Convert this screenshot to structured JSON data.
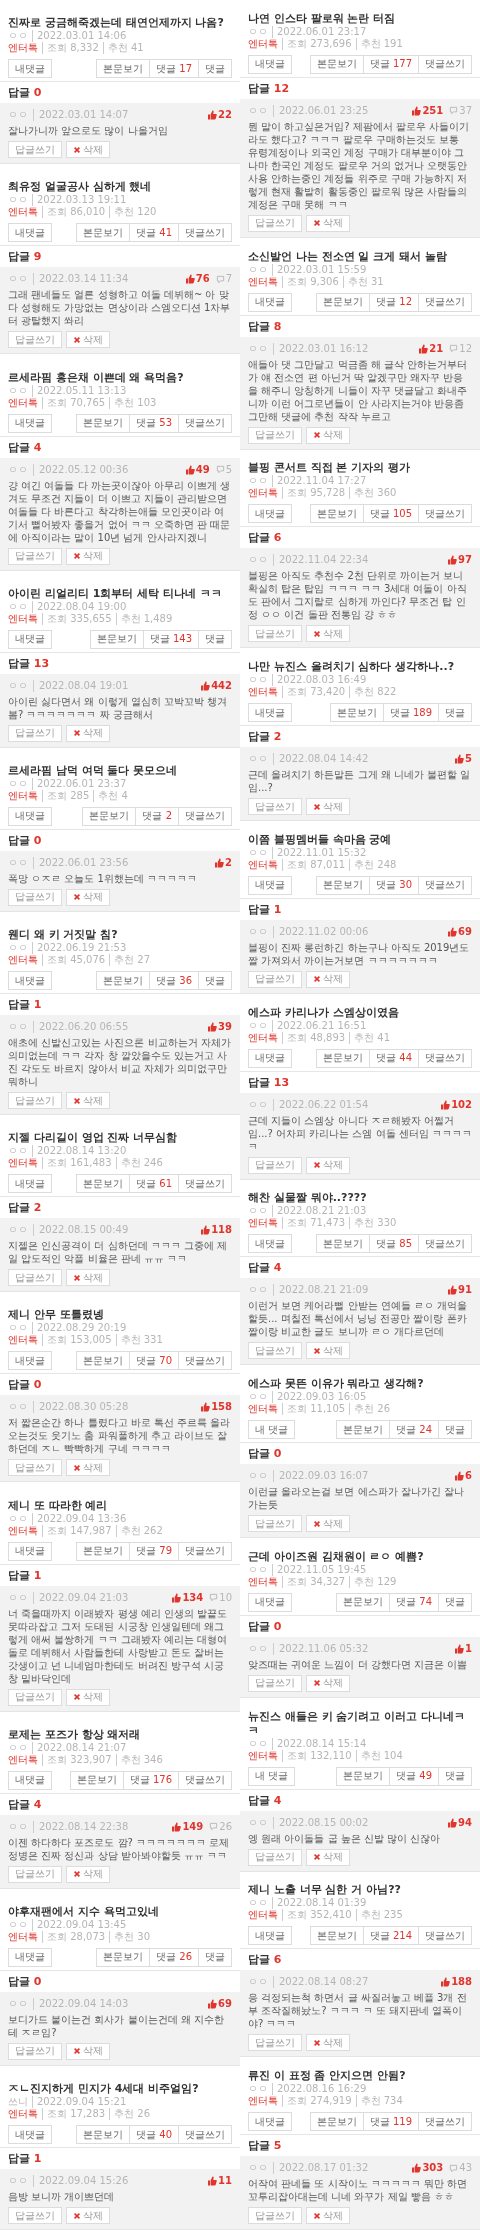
{
  "columns": [
    {
      "posts": [
        {
          "title": "진짜로 궁금해죽겠는데 태연언제까지 나옴?",
          "author": "ㅇㅇ",
          "date": "2022.03.01 14:06",
          "category": "엔터톡",
          "views": "조회 8,332",
          "recommends": "추천 41",
          "my_comments": "내댓글",
          "actions": [
            {
              "label": "본문보기"
            },
            {
              "label": "댓글",
              "count": "17"
            },
            {
              "label": "댓글"
            }
          ],
          "reply_header": {
            "label": "답글",
            "count": "0"
          },
          "reply": {
            "author": "ㅇㅇ",
            "date": "2022.03.01 14:07",
            "likes": "22",
            "text": "잘나가니까 앞으로도 많이 나올거임",
            "buttons": [
              {
                "kind": "reply",
                "label": "답글쓰기"
              },
              {
                "kind": "delete",
                "label": "삭제"
              }
            ]
          }
        },
        {
          "title": "최유정 얼굴공사 심하게 했네",
          "author": "ㅇㅇ",
          "date": "2022.03.13 19:11",
          "category": "엔터톡",
          "views": "조회 86,010",
          "recommends": "추천 120",
          "my_comments": "내댓글",
          "actions": [
            {
              "label": "본문보기"
            },
            {
              "label": "댓글",
              "count": "41"
            },
            {
              "label": "댓글쓰기"
            }
          ],
          "reply_header": {
            "label": "답글",
            "count": "9"
          },
          "reply": {
            "author": "ㅇㅇ",
            "date": "2022.03.14 11:34",
            "likes": "76",
            "dislikes": "7",
            "text": "그래 팬네들도 얼른 성형하고 여돌 데뷔해~ 아 맞다 성형해도 가망없는 면상이라 스엠오디션 1차부터 광탈했지 쏴리",
            "buttons": [
              {
                "kind": "reply",
                "label": "답글쓰기"
              },
              {
                "kind": "delete",
                "label": "삭제"
              }
            ]
          }
        },
        {
          "title": "르세라핌 홍은채 이쁜데 왜 욕먹음?",
          "author": "ㅇㅇ",
          "date": "2022.05.11 13:13",
          "category": "엔터톡",
          "views": "조회 70,765",
          "recommends": "추천 103",
          "my_comments": "내댓글",
          "actions": [
            {
              "label": "본문보기"
            },
            {
              "label": "댓글",
              "count": "53"
            },
            {
              "label": "댓글쓰기"
            }
          ],
          "reply_header": {
            "label": "답글",
            "count": "4"
          },
          "reply": {
            "author": "ㅇㅇ",
            "date": "2022.05.12 00:36",
            "likes": "49",
            "dislikes": "5",
            "text": "걍 여긴 여돌들 다 까는곳이잖아 아무리 이쁘게 생겨도 무조건 지들이 더 이쁘고 지들이 관리받으면 여돌들 다 바른다고 착각하는애들 모인곳이라 여기서 뻘어봤자 좋을거 없어 ㅋㅋ 오죽하면 판 때문에 아직이라는 말이 10년 넘게 안사라지겠니",
            "buttons": [
              {
                "kind": "reply",
                "label": "답글쓰기"
              },
              {
                "kind": "delete",
                "label": "삭제"
              }
            ]
          }
        },
        {
          "title": "아이린 리얼리티 1회부터 세탁 티나네 ㅋㅋ",
          "author": "ㅇㅇ",
          "date": "2022.08.04 19:00",
          "category": "엔터톡",
          "views": "조회 335,655",
          "recommends": "추천 1,489",
          "my_comments": "내댓글",
          "actions": [
            {
              "label": "본문보기"
            },
            {
              "label": "댓글",
              "count": "143"
            },
            {
              "label": "댓글"
            }
          ],
          "reply_header": {
            "label": "답글",
            "count": "13"
          },
          "reply": {
            "author": "ㅇㅇ",
            "date": "2022.08.04 19:01",
            "likes": "442",
            "text": "아이린 싫다면서 왜 이렇게 열심히 꼬박꼬박 챙겨봄? ㅋㅋㅋㅋㅋㅋㅋ 짜 궁금해서",
            "buttons": [
              {
                "kind": "reply",
                "label": "답글쓰기"
              },
              {
                "kind": "delete",
                "label": "삭제"
              }
            ]
          }
        },
        {
          "title": "르세라핌 남덕 여덕 둘다 못모으네",
          "author": "ㅇㅇ",
          "date": "2022.06.01 23:37",
          "category": "엔터톡",
          "views": "조회 285",
          "recommends": "추천 4",
          "my_comments": "내댓글",
          "actions": [
            {
              "label": "본문보기"
            },
            {
              "label": "댓글",
              "count": "2"
            },
            {
              "label": "댓글쓰기"
            }
          ],
          "reply_header": {
            "label": "답글",
            "count": "0"
          },
          "reply": {
            "author": "ㅇㅇ",
            "date": "2022.06.01 23:56",
            "likes": "2",
            "text": "폭망 ㅇㅈㄹ 오늘도 1위했는데 ㅋㅋㅋㅋㅋ",
            "buttons": [
              {
                "kind": "reply",
                "label": "답글쓰기"
              },
              {
                "kind": "delete",
                "label": "삭제"
              }
            ]
          }
        },
        {
          "title": "웬디 왜 키 거짓말 침?",
          "author": "ㅇㅇ",
          "date": "2022.06.19 21:53",
          "category": "엔터톡",
          "views": "조회 45,076",
          "recommends": "추천 27",
          "my_comments": "내댓글",
          "actions": [
            {
              "label": "본문보기"
            },
            {
              "label": "댓글",
              "count": "36"
            },
            {
              "label": "댓글"
            }
          ],
          "reply_header": {
            "label": "답글",
            "count": "1"
          },
          "reply": {
            "author": "ㅇㅇ",
            "date": "2022.06.20 06:55",
            "likes": "39",
            "text": "애초에 신발신고있는 사진으론 비교하는거 자체가 의미없는데 ㅋㅋ 각자 창 깔았을수도 있는거고 사진 각도도 바르지 않아서 비교 자체가 의미없구만 뭐하니",
            "buttons": [
              {
                "kind": "reply",
                "label": "답글쓰기"
              },
              {
                "kind": "delete",
                "label": "삭제"
              }
            ]
          }
        },
        {
          "title": "지젤 다리길이 영업 진짜 너무심함",
          "author": "ㅇㅇ",
          "date": "2022.08.14 13:20",
          "category": "엔터톡",
          "views": "조회 161,483",
          "recommends": "추천 246",
          "my_comments": "내댓글",
          "actions": [
            {
              "label": "본문보기"
            },
            {
              "label": "댓글",
              "count": "61"
            },
            {
              "label": "댓글쓰기"
            }
          ],
          "reply_header": {
            "label": "답글",
            "count": "2"
          },
          "reply": {
            "author": "ㅇㅇ",
            "date": "2022.08.15 00:49",
            "likes": "118",
            "text": "지젤은 인신공격이 더 심하던데 ㅋㅋㅋ 그중에 제일 압도적인 악플 비율은 판네 ㅠㅠ ㅋㅋ",
            "buttons": [
              {
                "kind": "reply",
                "label": "답글쓰기"
              },
              {
                "kind": "delete",
                "label": "삭제"
              }
            ]
          }
        },
        {
          "title": "제니 안무 또틀렸넹",
          "author": "ㅇㅇ",
          "date": "2022.08.29 20:19",
          "category": "엔터톡",
          "views": "조회 153,005",
          "recommends": "추천 331",
          "my_comments": "내댓글",
          "actions": [
            {
              "label": "본문보기"
            },
            {
              "label": "댓글",
              "count": "70"
            },
            {
              "label": "댓글쓰기"
            }
          ],
          "reply_header": {
            "label": "답글",
            "count": "0"
          },
          "reply": {
            "author": "ㅇㅇ",
            "date": "2022.08.30 05:28",
            "likes": "158",
            "text": "저 짧은순간 하나 틀렸다고 바로 톡선 주르륵 올라오는것도 웃기노 춤 파워풀하게 추고 라이브도 잘하던데 ㅈㄴ 빡빡하게 구네 ㅋㅋㅋㅋ",
            "buttons": [
              {
                "kind": "reply",
                "label": "답글쓰기"
              },
              {
                "kind": "delete",
                "label": "삭제"
              }
            ]
          }
        },
        {
          "title": "제니 또 따라한 예리",
          "author": "ㅇㅇ",
          "date": "2022.09.04 13:36",
          "category": "엔터톡",
          "views": "조회 147,987",
          "recommends": "추천 262",
          "my_comments": "내댓글",
          "actions": [
            {
              "label": "본문보기"
            },
            {
              "label": "댓글",
              "count": "79"
            },
            {
              "label": "댓글쓰기"
            }
          ],
          "reply_header": {
            "label": "답글",
            "count": "1"
          },
          "reply": {
            "author": "ㅇㅇ",
            "date": "2022.09.04 21:03",
            "likes": "134",
            "dislikes": "10",
            "text": "너 죽을때까지 이래봤자 평생 예리 인생의 발끝도 못따라잡고 그저 도태된 시궁창 인생일텐데 왜그렇게 애써 불쌍하게 ㅋㅋ 그래봤자 예리는 대형여돌로 데뷔해서 사람들한테 사랑받고 돈도 잘버는 갓생이고 넌 니네엄마한테도 버려진 방구석 시궁창 밑바닥인데",
            "buttons": [
              {
                "kind": "reply",
                "label": "답글쓰기"
              },
              {
                "kind": "delete",
                "label": "삭제"
              }
            ]
          }
        },
        {
          "title": "로제는 포즈가 항상 왜저래",
          "author": "ㅇㅇ",
          "date": "2022.08.14 21:07",
          "category": "엔터톡",
          "views": "조회 323,907",
          "recommends": "추천 346",
          "my_comments": "내댓글",
          "actions": [
            {
              "label": "본문보기"
            },
            {
              "label": "댓글",
              "count": "176"
            },
            {
              "label": "댓글쓰기"
            }
          ],
          "reply_header": {
            "label": "답글",
            "count": "4"
          },
          "reply": {
            "author": "ㅇㅇ",
            "date": "2022.08.14 22:38",
            "likes": "149",
            "dislikes": "26",
            "text": "이젠 하다하다 포즈로도 깜? ㅋㅋㅋㅋㅋㅋㅋ 로제 정병은 진짜 정신과 상담 받아봐야할듯 ㅠㅠ ㅋㅋ",
            "buttons": [
              {
                "kind": "reply",
                "label": "답글쓰기"
              },
              {
                "kind": "delete",
                "label": "삭제"
              }
            ]
          }
        },
        {
          "title": "야후재팬에서 지수 욕먹고있네",
          "author": "ㅇㅇ",
          "date": "2022.09.04 13:45",
          "category": "엔터톡",
          "views": "조회 28,073",
          "recommends": "추천 30",
          "my_comments": "내댓글",
          "actions": [
            {
              "label": "본문보기"
            },
            {
              "label": "댓글",
              "count": "26"
            },
            {
              "label": "댓글"
            }
          ],
          "reply_header": {
            "label": "답글",
            "count": "0"
          },
          "reply": {
            "author": "ㅇㅇ",
            "date": "2022.09.04 14:03",
            "likes": "69",
            "text": "보디가드 붙이는건 회사가 붙이는건데 왜 지수한테 ㅈㄹ임?",
            "buttons": [
              {
                "kind": "reply",
                "label": "답글쓰기"
              },
              {
                "kind": "delete",
                "label": "삭제"
              }
            ]
          }
        },
        {
          "title": "ㅈㄴ진지하게 민지가 4세대 비주얼임?",
          "author": "쓰니",
          "date": "2022.09.04 15:21",
          "category": "엔터톡",
          "views": "조회 17,283",
          "recommends": "추천 26",
          "my_comments": "내댓글",
          "actions": [
            {
              "label": "본문보기"
            },
            {
              "label": "댓글",
              "count": "40"
            },
            {
              "label": "댓글쓰기"
            }
          ],
          "reply_header": {
            "label": "답글",
            "count": "1"
          },
          "reply": {
            "author": "ㅇㅇ",
            "date": "2022.09.04 15:26",
            "likes": "11",
            "text": "음방 보니까 개이쁘던데",
            "buttons": [
              {
                "kind": "reply",
                "label": "답글쓰기"
              },
              {
                "kind": "delete",
                "label": "삭제"
              }
            ]
          }
        }
      ]
    },
    {
      "posts": [
        {
          "title": "나연 인스타 팔로워 논란 터짐",
          "author": "ㅇㅇ",
          "date": "2022.06.01 23:17",
          "category": "엔터톡",
          "views": "조회 273,696",
          "recommends": "추천 191",
          "my_comments": "내댓글",
          "actions": [
            {
              "label": "본문보기"
            },
            {
              "label": "댓글",
              "count": "177"
            },
            {
              "label": "댓글쓰기"
            }
          ],
          "reply_header": {
            "label": "답글",
            "count": "12"
          },
          "reply": {
            "author": "ㅇㅇ",
            "date": "2022.06.01 23:25",
            "likes": "251",
            "dislikes": "37",
            "text": "뭔 말이 하고싶은거임? 제팜에서 팔로우 사들이기라도 했다고? ㅋㅋㅋ 팔로우 구매하는것도 보통 유령계정이나 외국인 계정 구매가 대부분이야 그나마 한국인 계정도 팔로우 거의 없거나 오랫동안 사용 안하는중인 계정들 위주로 구매 가능하지 저렇게 현재 활발히 활동중인 팔로워 많은 사람들의 계정은 구매 못해 ㅋㅋ",
            "buttons": [
              {
                "kind": "reply",
                "label": "답글쓰기"
              },
              {
                "kind": "delete",
                "label": "삭제"
              }
            ]
          }
        },
        {
          "title": "소신발언 나는 전소연 일 크게 돼서 놀람",
          "author": "ㅇㅇ",
          "date": "2022.03.01 15:59",
          "category": "엔터톡",
          "views": "조회 9,306",
          "recommends": "추천 31",
          "my_comments": "내댓글",
          "actions": [
            {
              "label": "본문보기"
            },
            {
              "label": "댓글",
              "count": "12"
            },
            {
              "label": "댓글쓰기"
            }
          ],
          "reply_header": {
            "label": "답글",
            "count": "8"
          },
          "reply": {
            "author": "ㅇㅇ",
            "date": "2022.03.01 16:12",
            "likes": "21",
            "dislikes": "12",
            "text": "애들아 댓 그만달고 먹금좀 해 글삭 안하는거부터가 얘 전소연 편 아닌거 딱 알겠구만 왜자꾸 반응을 해주니 앙칭하게 니들이 자꾸 댓글달고 화내주니까 이런 어그로년들이 안 사라지는거야 반응좀 그만해 댓글에 추천 작작 누르고",
            "buttons": [
              {
                "kind": "reply",
                "label": "답글쓰기"
              },
              {
                "kind": "delete",
                "label": "삭제"
              }
            ]
          }
        },
        {
          "title": "블핑 콘서트 직접 본 기자의 평가",
          "author": "ㅇㅇ",
          "date": "2022.11.04 17:27",
          "category": "엔터톡",
          "views": "조회 95,728",
          "recommends": "추천 360",
          "my_comments": "내댓글",
          "actions": [
            {
              "label": "본문보기"
            },
            {
              "label": "댓글",
              "count": "105"
            },
            {
              "label": "댓글쓰기"
            }
          ],
          "reply_header": {
            "label": "답글",
            "count": "6"
          },
          "reply": {
            "author": "ㅇㅇ",
            "date": "2022.11.04 22:34",
            "likes": "97",
            "text": "블핑은 아직도 추천수 2천 단위로 까이는거 보니 확실히 탑은 탑임 ㅋㅋㅋ ㅋㅋ 3세대 여돌이 아직도 판에서 그지랄로 심하게 까인다? 무조건 탑 인정 ㅇㅇ 이건 돌판 전통임 걍 ㅎㅎ",
            "buttons": [
              {
                "kind": "reply",
                "label": "답글쓰기"
              },
              {
                "kind": "delete",
                "label": "삭제"
              }
            ]
          }
        },
        {
          "title": "나만 뉴진스 올려치기 심하다 생각하나..?",
          "author": "ㅇㅇ",
          "date": "2022.08.03 16:49",
          "category": "엔터톡",
          "views": "조회 73,420",
          "recommends": "추천 822",
          "my_comments": "내댓글",
          "actions": [
            {
              "label": "본문보기"
            },
            {
              "label": "댓글",
              "count": "189"
            },
            {
              "label": "댓글"
            }
          ],
          "reply_header": {
            "label": "답글",
            "count": "2"
          },
          "reply": {
            "author": "ㅇㅇ",
            "date": "2022.08.04 14:42",
            "likes": "5",
            "text": "근데 올려치기 하든말든 그게 왜 니네가 불편할 일임...?",
            "buttons": [
              {
                "kind": "reply",
                "label": "답글쓰기"
              },
              {
                "kind": "delete",
                "label": "삭제"
              }
            ]
          }
        },
        {
          "title": "이쯤 블핑멤버들 속마음 궁예",
          "author": "ㅇㅇ",
          "date": "2022.11.01 15:32",
          "category": "엔터톡",
          "views": "조회 87,011",
          "recommends": "추천 248",
          "my_comments": "내댓글",
          "actions": [
            {
              "label": "본문보기"
            },
            {
              "label": "댓글",
              "count": "30"
            },
            {
              "label": "댓글쓰기"
            }
          ],
          "reply_header": {
            "label": "답글",
            "count": "1"
          },
          "reply": {
            "author": "ㅇㅇ",
            "date": "2022.11.02 00:06",
            "likes": "69",
            "text": "블핑이 진짜 롱런하긴 하는구나 아직도 2019년도 짤 가져와서 까이는거보면 ㅋㅋㅋㅋㅋㅋㅋ",
            "buttons": [
              {
                "kind": "reply",
                "label": "답글쓰기"
              },
              {
                "kind": "delete",
                "label": "삭제"
              }
            ]
          }
        },
        {
          "title": "에스파 카리나가 스엠상이였음",
          "author": "ㅇㅇ",
          "date": "2022.06.21 16:51",
          "category": "엔터톡",
          "views": "조회 48,893",
          "recommends": "추천 41",
          "my_comments": "내댓글",
          "actions": [
            {
              "label": "본문보기"
            },
            {
              "label": "댓글",
              "count": "44"
            },
            {
              "label": "댓글쓰기"
            }
          ],
          "reply_header": {
            "label": "답글",
            "count": "13"
          },
          "reply": {
            "author": "ㅇㅇ",
            "date": "2022.06.22 01:54",
            "likes": "102",
            "text": "근데 지들이 스엠상 아니다 ㅈㄹ해봤자 어쩔거임...? 어차피 카리나는 스엠 여돌 센터임 ㅋㅋㅋㅋㅋ",
            "buttons": [
              {
                "kind": "reply",
                "label": "답글쓰기"
              },
              {
                "kind": "delete",
                "label": "삭제"
              }
            ]
          }
        },
        {
          "title": "해찬 실물짤 뭐야..????",
          "author": "ㅇㅇ",
          "date": "2022.08.21 21:03",
          "category": "엔터톡",
          "views": "조회 71,473",
          "recommends": "추천 330",
          "my_comments": "내댓글",
          "actions": [
            {
              "label": "본문보기"
            },
            {
              "label": "댓글",
              "count": "85"
            },
            {
              "label": "댓글쓰기"
            }
          ],
          "reply_header": {
            "label": "답글",
            "count": "4"
          },
          "reply": {
            "author": "ㅇㅇ",
            "date": "2022.08.21 21:09",
            "likes": "91",
            "text": "이런거 보면 케어라뻘 안받는 연예들 ㄹㅇ 개억울할듯... 며칠전 톡선에서 닝닝 전공만 짤이랑 폰카짤이랑 비교한 글도 보니까 ㄹㅇ 개다르던데",
            "buttons": [
              {
                "kind": "reply",
                "label": "답글쓰기"
              },
              {
                "kind": "delete",
                "label": "삭제"
              }
            ]
          }
        },
        {
          "title": "에스파 못뜬 이유가 뭐라고 생각해?",
          "author": "ㅇㅇ",
          "date": "2022.09.03 16:05",
          "category": "엔터톡",
          "views": "조회 11,105",
          "recommends": "추천 26",
          "my_comments": "내 댓글",
          "actions": [
            {
              "label": "본문보기"
            },
            {
              "label": "댓글",
              "count": "24"
            },
            {
              "label": "댓글"
            }
          ],
          "reply_header": {
            "label": "답글",
            "count": "0"
          },
          "reply": {
            "author": "ㅇㅇ",
            "date": "2022.09.03 16:07",
            "likes": "6",
            "text": "이런글 올라오는걸 보면 에스파가 잘나가긴 잘나가는듯",
            "buttons": [
              {
                "kind": "reply",
                "label": "답글쓰기"
              },
              {
                "kind": "delete",
                "label": "삭제"
              }
            ]
          }
        },
        {
          "title": "근데 아이즈원 김채원이 ㄹㅇ 예쁨?",
          "author": "ㅇㅇ",
          "date": "2022.11.05 19:45",
          "category": "엔터톡",
          "views": "조회 34,327",
          "recommends": "추천 129",
          "my_comments": "내댓글",
          "actions": [
            {
              "label": "본문보기"
            },
            {
              "label": "댓글",
              "count": "74"
            },
            {
              "label": "댓글"
            }
          ],
          "reply_header": {
            "label": "답글",
            "count": "0"
          },
          "reply": {
            "author": "ㅇㅇ",
            "date": "2022.11.06 05:32",
            "likes": "1",
            "text": "앚즈때는 귀여운 느낌이 더 강했다면 지금은 이쁨",
            "buttons": [
              {
                "kind": "reply",
                "label": "답글쓰기"
              },
              {
                "kind": "delete",
                "label": "삭제"
              }
            ]
          }
        },
        {
          "title": "뉴진스 애들은 키 숨기려고 이러고 다니네ㅋㅋ",
          "author": "ㅇㅇ",
          "date": "2022.08.14 15:14",
          "category": "엔터톡",
          "views": "조회 132,110",
          "recommends": "추천 104",
          "my_comments": "내 댓글",
          "actions": [
            {
              "label": "본문보기"
            },
            {
              "label": "댓글",
              "count": "49"
            },
            {
              "label": "댓글"
            }
          ],
          "reply_header": {
            "label": "답글",
            "count": "4"
          },
          "reply": {
            "author": "ㅇㅇ",
            "date": "2022.08.15 00:02",
            "likes": "94",
            "text": "엥 원래 아이돌들 굽 높은 신발 많이 신잖아",
            "buttons": [
              {
                "kind": "reply",
                "label": "답글쓰기"
              },
              {
                "kind": "delete",
                "label": "삭제"
              }
            ]
          }
        },
        {
          "title": "제니 노출 너무 심한 거 아님??",
          "author": "ㅇㅇ",
          "date": "2022.08.14 01:39",
          "category": "엔터톡",
          "views": "조회 352,410",
          "recommends": "추천 235",
          "my_comments": "내댓글",
          "actions": [
            {
              "label": "본문보기"
            },
            {
              "label": "댓글",
              "count": "214"
            },
            {
              "label": "댓글쓰기"
            }
          ],
          "reply_header": {
            "label": "답글",
            "count": "6"
          },
          "reply": {
            "author": "ㅇㅇ",
            "date": "2022.08.14 08:27",
            "likes": "188",
            "text": "응 걱정되는척 하면서 글 싸질러놓고 베플 3개 전부 조작질해놨노? ㅋㅋㅋ ㅋ 또 돼지판네 열폭이야? ㅋㅋㅋ",
            "buttons": [
              {
                "kind": "reply",
                "label": "답글쓰기"
              },
              {
                "kind": "delete",
                "label": "삭제"
              }
            ]
          }
        },
        {
          "title": "류진 이 표정 좀 안지으면 안됨?",
          "author": "ㅇㅇ",
          "date": "2022.08.16 16:29",
          "category": "엔터톡",
          "views": "조회 274,919",
          "recommends": "추천 734",
          "my_comments": "내댓글",
          "actions": [
            {
              "label": "본문보기"
            },
            {
              "label": "댓글",
              "count": "119"
            },
            {
              "label": "댓글쓰기"
            }
          ],
          "reply_header": {
            "label": "답글",
            "count": "5"
          },
          "reply": {
            "author": "ㅇㅇ",
            "date": "2022.08.17 01:32",
            "likes": "303",
            "dislikes": "43",
            "text": "어작여 판네들 또 시작이노 ㅋㅋㅋㅋㅋ 뭐만 하면 꼬투리잡아대는데 니네 와꾸가 제일 빻음 ㅎㅎ",
            "buttons": [
              {
                "kind": "reply",
                "label": "답글쓰기"
              },
              {
                "kind": "delete",
                "label": "삭제"
              }
            ]
          }
        }
      ]
    }
  ]
}
